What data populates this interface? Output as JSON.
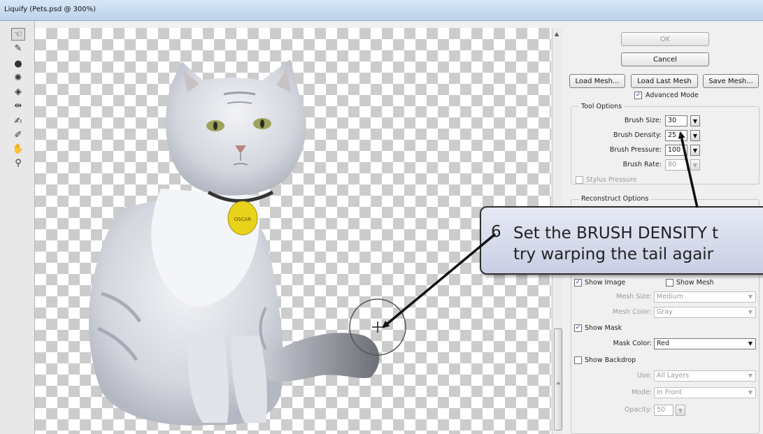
{
  "window": {
    "title": "Liquify (Pets.psd @ 300%)"
  },
  "tools": [
    {
      "name": "forward-warp-tool-icon",
      "glyph": "☜"
    },
    {
      "name": "reconstruct-tool-icon",
      "glyph": "✎"
    },
    {
      "name": "twirl-clockwise-tool-icon",
      "glyph": "●"
    },
    {
      "name": "pucker-tool-icon",
      "glyph": "✺"
    },
    {
      "name": "bloat-tool-icon",
      "glyph": "◈"
    },
    {
      "name": "push-left-tool-icon",
      "glyph": "⇹"
    },
    {
      "name": "freeze-mask-tool-icon",
      "glyph": "✍"
    },
    {
      "name": "thaw-mask-tool-icon",
      "glyph": "✐"
    },
    {
      "name": "hand-tool-icon",
      "glyph": "✋"
    },
    {
      "name": "zoom-tool-icon",
      "glyph": "⚲"
    }
  ],
  "panel": {
    "ok_label": "OK",
    "cancel_label": "Cancel",
    "load_mesh_label": "Load Mesh...",
    "load_last_mesh_label": "Load Last Mesh",
    "save_mesh_label": "Save Mesh...",
    "advanced_mode_label": "Advanced Mode",
    "advanced_mode_checked": true,
    "tool_options": {
      "title": "Tool Options",
      "brush_size_label": "Brush Size:",
      "brush_size_value": "30",
      "brush_density_label": "Brush Density:",
      "brush_density_value": "25",
      "brush_pressure_label": "Brush Pressure:",
      "brush_pressure_value": "100",
      "brush_rate_label": "Brush Rate:",
      "brush_rate_value": "80",
      "stylus_pressure_label": "Stylus Pressure"
    },
    "reconstruct_options": {
      "title": "Reconstruct Options"
    },
    "view_options": {
      "show_image_label": "Show Image",
      "show_image_checked": true,
      "show_mesh_label": "Show Mesh",
      "show_mesh_checked": false,
      "mesh_size_label": "Mesh Size:",
      "mesh_size_value": "Medium",
      "mesh_color_label": "Mesh Color:",
      "mesh_color_value": "Gray",
      "show_mask_label": "Show Mask",
      "show_mask_checked": true,
      "mask_color_label": "Mask Color:",
      "mask_color_value": "Red",
      "show_backdrop_label": "Show Backdrop",
      "show_backdrop_checked": false,
      "use_label": "Use:",
      "use_value": "All Layers",
      "mode_label": "Mode:",
      "mode_value": "In Front",
      "opacity_label": "Opacity:",
      "opacity_value": "50"
    }
  },
  "callout": {
    "number": "6",
    "line1": "Set the BRUSH DENSITY t",
    "line2": "try warping the tail agair"
  },
  "colors": {
    "callout_fill": "#d6dbec",
    "checker": "#cccccc",
    "collar_tag": "#e8d21a"
  }
}
